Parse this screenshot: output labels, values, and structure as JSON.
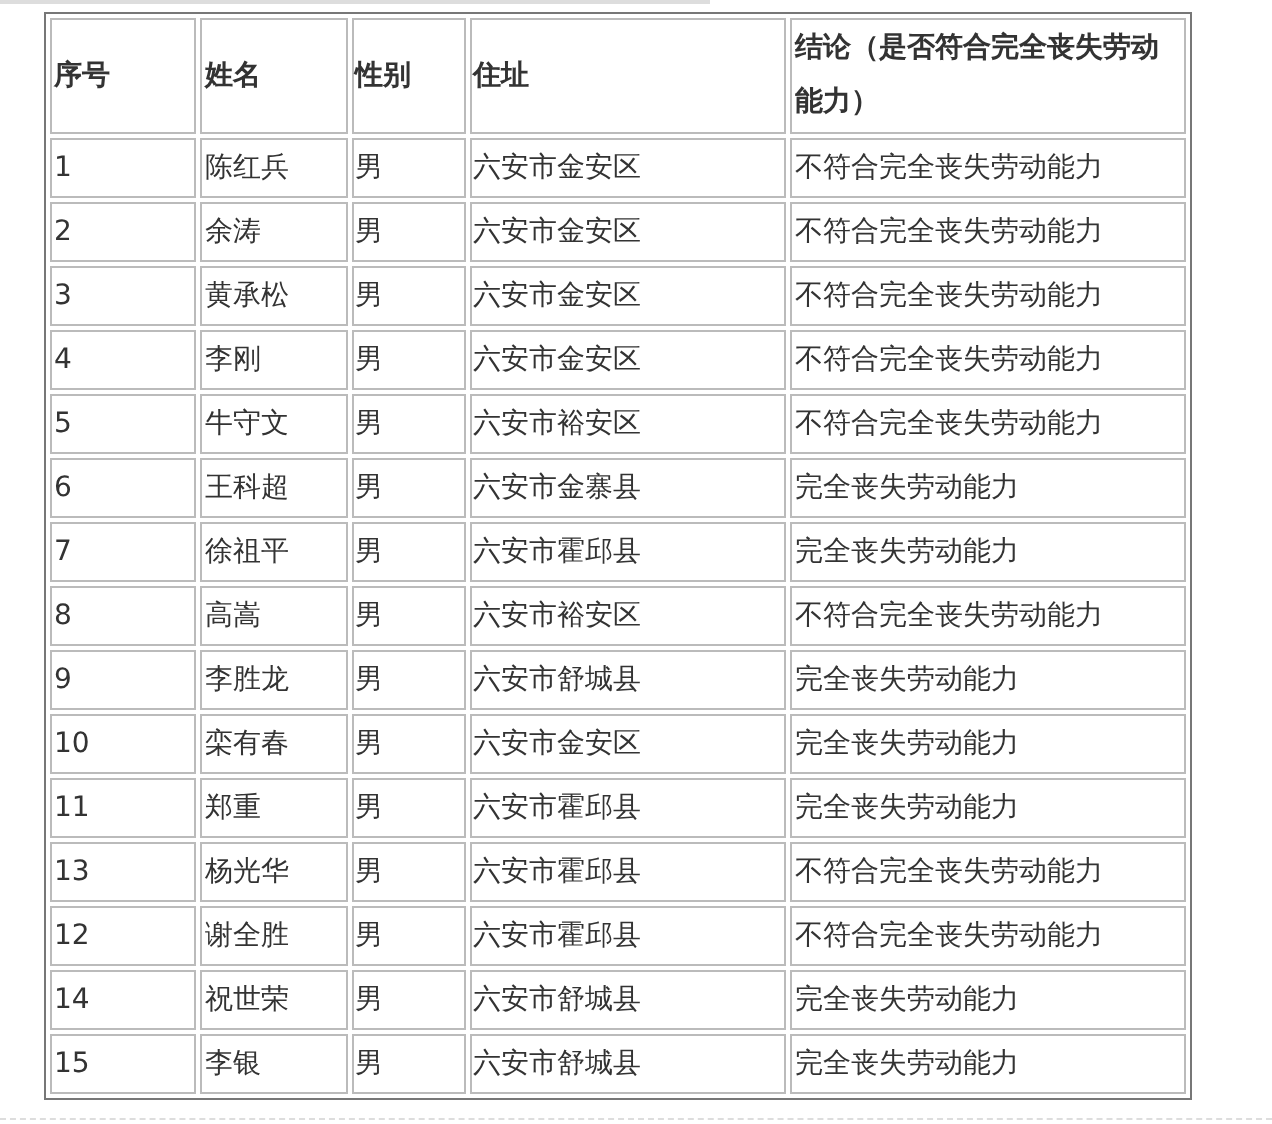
{
  "table": {
    "columns": [
      "序号",
      "姓名",
      "性别",
      "住址",
      "结论（是否符合完全丧失劳动能力）"
    ],
    "rows": [
      [
        "1",
        "陈红兵",
        "男",
        "六安市金安区",
        "不符合完全丧失劳动能力"
      ],
      [
        "2",
        "余涛",
        "男",
        "六安市金安区",
        "不符合完全丧失劳动能力"
      ],
      [
        "3",
        "黄承松",
        "男",
        "六安市金安区",
        "不符合完全丧失劳动能力"
      ],
      [
        "4",
        "李刚",
        "男",
        "六安市金安区",
        "不符合完全丧失劳动能力"
      ],
      [
        "5",
        "牛守文",
        "男",
        "六安市裕安区",
        "不符合完全丧失劳动能力"
      ],
      [
        "6",
        "王科超",
        "男",
        "六安市金寨县",
        "完全丧失劳动能力"
      ],
      [
        "7",
        "徐祖平",
        "男",
        "六安市霍邱县",
        "完全丧失劳动能力"
      ],
      [
        "8",
        "高嵩",
        "男",
        "六安市裕安区",
        "不符合完全丧失劳动能力"
      ],
      [
        "9",
        "李胜龙",
        "男",
        "六安市舒城县",
        "完全丧失劳动能力"
      ],
      [
        "10",
        "栾有春",
        "男",
        "六安市金安区",
        "完全丧失劳动能力"
      ],
      [
        "11",
        "郑重",
        "男",
        "六安市霍邱县",
        "完全丧失劳动能力"
      ],
      [
        "13",
        "杨光华",
        "男",
        "六安市霍邱县",
        "不符合完全丧失劳动能力"
      ],
      [
        "12",
        "谢全胜",
        "男",
        "六安市霍邱县",
        "不符合完全丧失劳动能力"
      ],
      [
        "14",
        "祝世荣",
        "男",
        "六安市舒城县",
        "完全丧失劳动能力"
      ],
      [
        "15",
        "李银",
        "男",
        "六安市舒城县",
        "完全丧失劳动能力"
      ]
    ]
  }
}
